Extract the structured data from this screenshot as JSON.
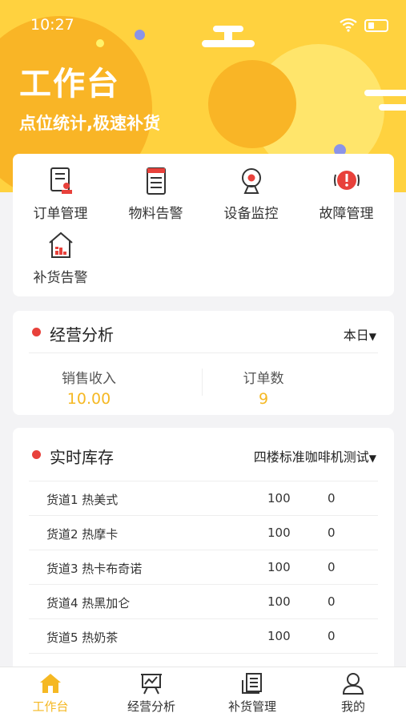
{
  "status_bar": {
    "time": "10:27"
  },
  "header": {
    "title": "工作台",
    "subtitle": "点位统计,极速补货"
  },
  "menu": [
    {
      "label": "订单管理",
      "icon": "order-doc-icon"
    },
    {
      "label": "物料告警",
      "icon": "material-list-icon"
    },
    {
      "label": "设备监控",
      "icon": "camera-icon"
    },
    {
      "label": "故障管理",
      "icon": "alert-icon"
    },
    {
      "label": "补货告警",
      "icon": "restock-house-icon"
    }
  ],
  "analysis": {
    "title": "经营分析",
    "period": "本日",
    "sales_label": "销售收入",
    "sales_value": "10.00",
    "orders_label": "订单数",
    "orders_value": "9"
  },
  "stock": {
    "title": "实时库存",
    "machine": "四楼标准咖啡机测试",
    "rows": [
      {
        "name": "货道1 热美式",
        "qty": "100",
        "zero": "0"
      },
      {
        "name": "货道2 热摩卡",
        "qty": "100",
        "zero": "0"
      },
      {
        "name": "货道3 热卡布奇诺",
        "qty": "100",
        "zero": "0"
      },
      {
        "name": "货道4 热黑加仑",
        "qty": "100",
        "zero": "0"
      },
      {
        "name": "货道5 热奶茶",
        "qty": "100",
        "zero": "0"
      }
    ]
  },
  "tabs": [
    {
      "label": "工作台",
      "icon": "home-icon",
      "active": true
    },
    {
      "label": "经营分析",
      "icon": "chart-board-icon",
      "active": false
    },
    {
      "label": "补货管理",
      "icon": "restock-list-icon",
      "active": false
    },
    {
      "label": "我的",
      "icon": "user-icon",
      "active": false
    }
  ],
  "colors": {
    "accent": "#f5b823",
    "hero": "#ffd23f",
    "dot": "#e8413b"
  }
}
